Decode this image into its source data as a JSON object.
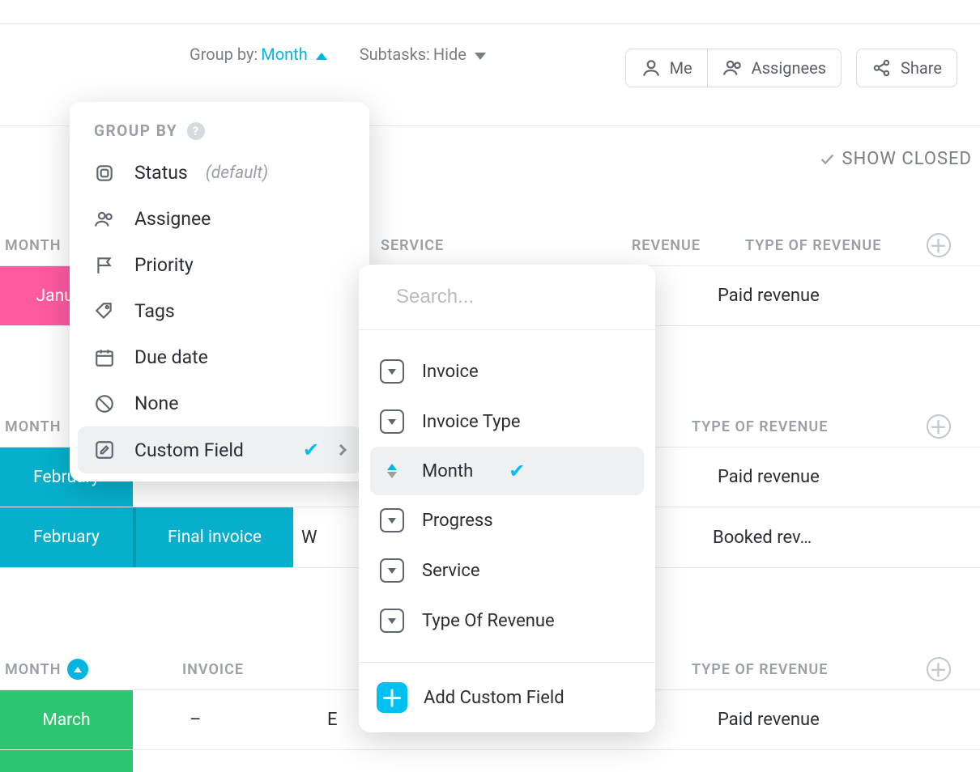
{
  "filters": {
    "groupby_label": "Group by:",
    "groupby_value": "Month",
    "subtasks_label": "Subtasks:",
    "subtasks_value": "Hide"
  },
  "toolbar": {
    "me": "Me",
    "assignees": "Assignees",
    "share": "Share"
  },
  "show_closed": "SHOW CLOSED",
  "columns": {
    "month": "MONTH",
    "invoice": "INVOICE",
    "service": "SERVICE",
    "revenue": "REVENUE",
    "type": "TYPE OF REVENUE"
  },
  "rows": {
    "jan": {
      "month": "January",
      "type": "Paid revenue"
    },
    "feb1": {
      "month": "February",
      "type": "Paid revenue"
    },
    "feb2": {
      "month": "February",
      "invoice": "Final invoice",
      "service_prefix": "W",
      "type": "Booked rev…"
    },
    "mar": {
      "month": "March",
      "invoice": "–",
      "service_prefix": "E",
      "type": "Paid revenue"
    }
  },
  "groupby_popup": {
    "title": "GROUP BY",
    "items": {
      "status": {
        "label": "Status",
        "meta": "(default)"
      },
      "assignee": "Assignee",
      "priority": "Priority",
      "tags": "Tags",
      "duedate": "Due date",
      "none": "None",
      "custom": "Custom Field"
    }
  },
  "cf_popup": {
    "placeholder": "Search...",
    "items": {
      "invoice": "Invoice",
      "invoice_type": "Invoice Type",
      "month": "Month",
      "progress": "Progress",
      "service": "Service",
      "type_rev": "Type Of Revenue"
    },
    "add": "Add Custom Field"
  }
}
